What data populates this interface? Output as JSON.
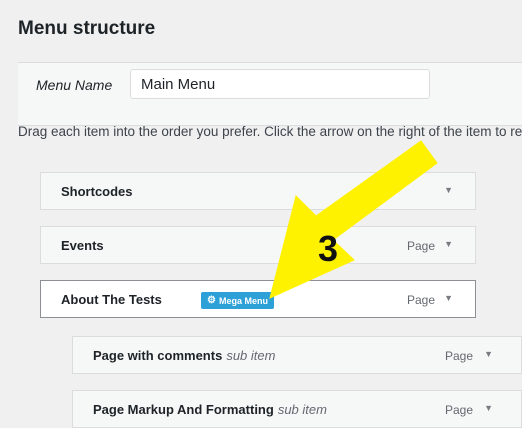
{
  "section": {
    "title": "Menu structure"
  },
  "menu_name": {
    "label": "Menu Name",
    "value": "Main Menu"
  },
  "instructions": "Drag each item into the order you prefer. Click the arrow on the right of the item to reveal additional configuration options.",
  "items": [
    {
      "title": "Shortcodes",
      "type": "",
      "sub": ""
    },
    {
      "title": "Events",
      "type": "Page",
      "sub": ""
    },
    {
      "title": "About The Tests",
      "type": "Page",
      "sub": "",
      "badge": "Mega Menu"
    },
    {
      "title": "Page with comments",
      "type": "Page",
      "sub": "sub item"
    },
    {
      "title": "Page Markup And Formatting",
      "type": "Page",
      "sub": "sub item"
    }
  ],
  "annotation": {
    "number": "3",
    "arrow_color": "#fff200",
    "icon": "arrow-icon"
  },
  "colors": {
    "badge": "#2ea0d8",
    "background": "#f0f0f1"
  }
}
